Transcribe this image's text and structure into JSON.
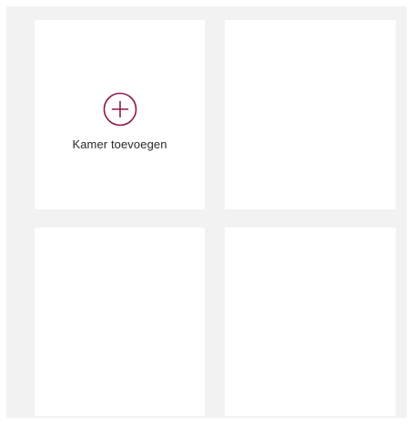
{
  "rooms": {
    "add_room_label": "Kamer toevoegen",
    "add_icon": "plus-circle-icon"
  },
  "colors": {
    "accent": "#8b1a4a",
    "panel_background": "#f2f2f2",
    "card_background": "#ffffff",
    "text": "#2a2a2a"
  }
}
